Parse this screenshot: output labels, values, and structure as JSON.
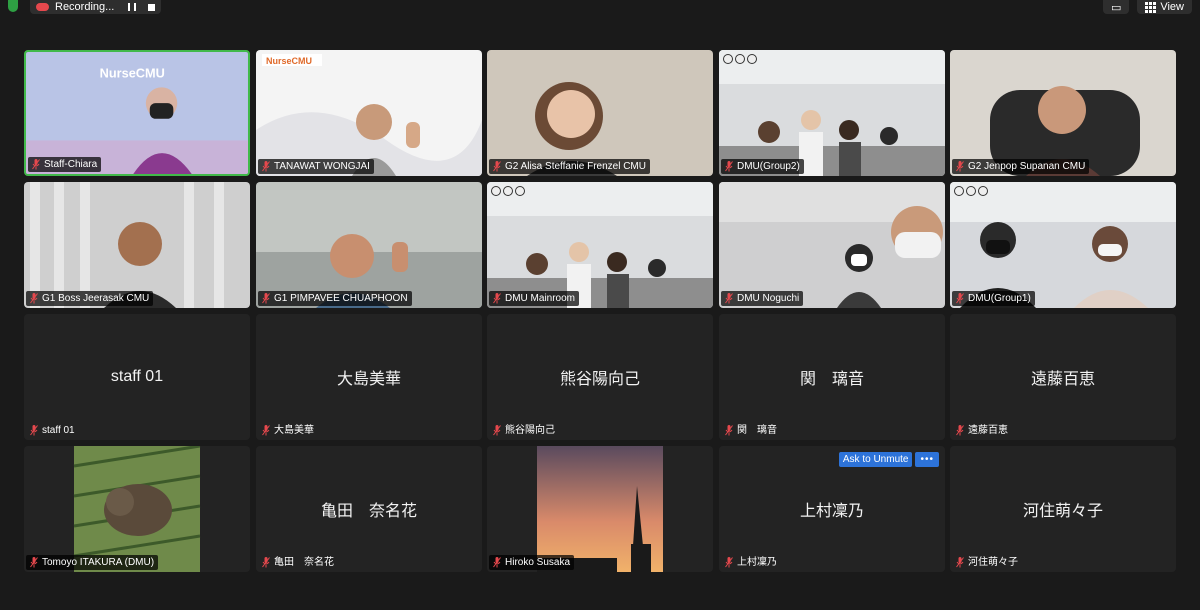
{
  "toolbar": {
    "recording_label": "Recording...",
    "view_label": "View"
  },
  "tiles": [
    {
      "name": "Staff-Chiara",
      "kind": "video",
      "scene": "nurse",
      "logo": "NurseCMU",
      "active": true
    },
    {
      "name": "TANAWAT WONGJAI",
      "kind": "video",
      "scene": "slide",
      "logo": "NurseCMU"
    },
    {
      "name": "G2 Alisa Steffanie Frenzel CMU",
      "kind": "video",
      "scene": "face"
    },
    {
      "name": "DMU(Group2)",
      "kind": "video",
      "scene": "room",
      "badges": true
    },
    {
      "name": "G2 Jenpop Supanan CMU",
      "kind": "video",
      "scene": "face2"
    },
    {
      "name": "G1 Boss Jeerasak CMU",
      "kind": "video",
      "scene": "curtain"
    },
    {
      "name": "G1 PIMPAVEE CHUAPHOON",
      "kind": "video",
      "scene": "peace"
    },
    {
      "name": "DMU Mainroom",
      "kind": "video",
      "scene": "room",
      "badges": true
    },
    {
      "name": "DMU Noguchi",
      "kind": "video",
      "scene": "room2"
    },
    {
      "name": "DMU(Group1)",
      "kind": "video",
      "scene": "room3",
      "badges": true
    },
    {
      "name": "staff 01",
      "kind": "name",
      "display": "staff 01"
    },
    {
      "name": "大島美華",
      "kind": "name",
      "display": "大島美華"
    },
    {
      "name": "熊谷陽向己",
      "kind": "name",
      "display": "熊谷陽向己"
    },
    {
      "name": "関　璃音",
      "kind": "name",
      "display": "関　璃音"
    },
    {
      "name": "遠藤百恵",
      "kind": "name",
      "display": "遠藤百恵"
    },
    {
      "name": "Tomoyo ITAKURA (DMU)",
      "kind": "picture",
      "scene": "cat"
    },
    {
      "name": "亀田　奈名花",
      "kind": "name",
      "display": "亀田　奈名花"
    },
    {
      "name": "Hiroko Susaka",
      "kind": "picture",
      "scene": "sunset"
    },
    {
      "name": "上村凜乃",
      "kind": "name",
      "display": "上村凜乃",
      "ask_unmute": "Ask to Unmute"
    },
    {
      "name": "河住萌々子",
      "kind": "name",
      "display": "河住萌々子"
    }
  ],
  "colors": {
    "active_border": "#41b94a",
    "tile_bg": "#232323",
    "mic_muted": "#e5484d",
    "unmute_btn": "#2d73d9"
  }
}
